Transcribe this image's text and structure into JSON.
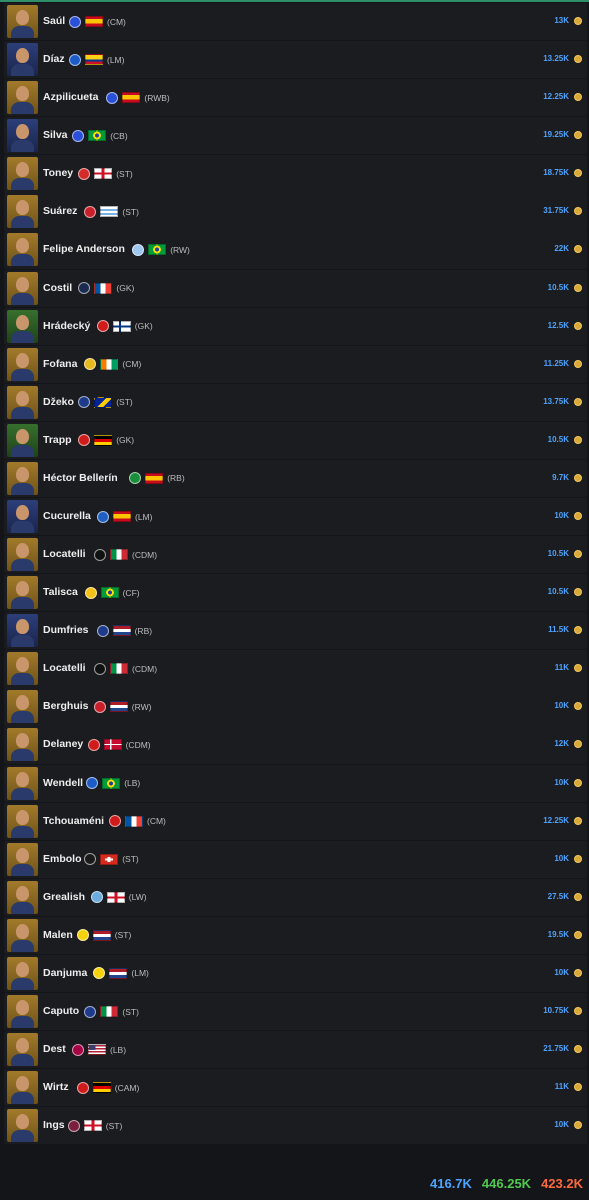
{
  "players": [
    {
      "name": "Saúl",
      "pos": "(CM)",
      "price": "13K",
      "club": "#2a4fd8",
      "flag": "es",
      "avatar": "gold"
    },
    {
      "name": "Díaz",
      "pos": "(LM)",
      "price": "13.25K",
      "club": "#1d5cc8",
      "flag": "co",
      "avatar": "blue"
    },
    {
      "name": "Azpilicueta",
      "pos": "(RWB)",
      "price": "12.25K",
      "club": "#2a4fd8",
      "flag": "es",
      "avatar": "gold"
    },
    {
      "name": "Silva",
      "pos": "(CB)",
      "price": "19.25K",
      "club": "#2a4fd8",
      "flag": "br",
      "avatar": "blue"
    },
    {
      "name": "Toney",
      "pos": "(ST)",
      "price": "18.75K",
      "club": "#d42a2a",
      "flag": "en",
      "avatar": "gold"
    },
    {
      "name": "Suárez",
      "pos": "(ST)",
      "price": "31.75K",
      "club": "#c8202b",
      "flag": "uy",
      "avatar": "gold"
    },
    {
      "name": "Felipe Anderson",
      "pos": "(RW)",
      "price": "22K",
      "club": "#9ec8ef",
      "flag": "br",
      "avatar": "gold"
    },
    {
      "name": "Costil",
      "pos": "(GK)",
      "price": "10.5K",
      "club": "#1b2a4e",
      "flag": "fr",
      "avatar": "gold"
    },
    {
      "name": "Hrádecký",
      "pos": "(GK)",
      "price": "12.5K",
      "club": "#d01b1b",
      "flag": "fi",
      "avatar": "green"
    },
    {
      "name": "Fofana",
      "pos": "(CM)",
      "price": "11.25K",
      "club": "#e7b91c",
      "flag": "ci",
      "avatar": "gold"
    },
    {
      "name": "Džeko",
      "pos": "(ST)",
      "price": "13.75K",
      "club": "#1e3a8a",
      "flag": "ba",
      "avatar": "gold"
    },
    {
      "name": "Trapp",
      "pos": "(GK)",
      "price": "10.5K",
      "club": "#d01b1b",
      "flag": "de",
      "avatar": "green"
    },
    {
      "name": "Héctor Bellerín",
      "pos": "(RB)",
      "price": "9.7K",
      "club": "#1a8f3b",
      "flag": "es",
      "avatar": "gold"
    },
    {
      "name": "Cucurella",
      "pos": "(LM)",
      "price": "10K",
      "club": "#1f5fc2",
      "flag": "es",
      "avatar": "blue"
    },
    {
      "name": "Locatelli",
      "pos": "(CDM)",
      "price": "10.5K",
      "club": "#111111",
      "flag": "it",
      "avatar": "gold"
    },
    {
      "name": "Talisca",
      "pos": "(CF)",
      "price": "10.5K",
      "club": "#f2c11a",
      "flag": "br",
      "avatar": "gold"
    },
    {
      "name": "Dumfries",
      "pos": "(RB)",
      "price": "11.5K",
      "club": "#1e3a8a",
      "flag": "nl",
      "avatar": "blue"
    },
    {
      "name": "Locatelli",
      "pos": "(CDM)",
      "price": "11K",
      "club": "#111111",
      "flag": "it",
      "avatar": "gold"
    },
    {
      "name": "Berghuis",
      "pos": "(RW)",
      "price": "10K",
      "club": "#c8202b",
      "flag": "nl",
      "avatar": "gold"
    },
    {
      "name": "Delaney",
      "pos": "(CDM)",
      "price": "12K",
      "club": "#d01b1b",
      "flag": "dk",
      "avatar": "gold"
    },
    {
      "name": "Wendell",
      "pos": "(LB)",
      "price": "10K",
      "club": "#1d5cc8",
      "flag": "br",
      "avatar": "gold"
    },
    {
      "name": "Tchouaméni",
      "pos": "(CM)",
      "price": "12.25K",
      "club": "#d01b1b",
      "flag": "fr",
      "avatar": "gold"
    },
    {
      "name": "Embolo",
      "pos": "(ST)",
      "price": "10K",
      "club": "#1a1a1a",
      "flag": "ch",
      "avatar": "gold"
    },
    {
      "name": "Grealish",
      "pos": "(LW)",
      "price": "27.5K",
      "club": "#6cabdd",
      "flag": "en",
      "avatar": "gold"
    },
    {
      "name": "Malen",
      "pos": "(ST)",
      "price": "19.5K",
      "club": "#f5d20c",
      "flag": "nl",
      "avatar": "gold"
    },
    {
      "name": "Danjuma",
      "pos": "(LM)",
      "price": "10K",
      "club": "#f5d20c",
      "flag": "nl",
      "avatar": "gold"
    },
    {
      "name": "Caputo",
      "pos": "(ST)",
      "price": "10.75K",
      "club": "#1e3a8a",
      "flag": "it",
      "avatar": "gold"
    },
    {
      "name": "Dest",
      "pos": "(LB)",
      "price": "21.75K",
      "club": "#a50044",
      "flag": "us",
      "avatar": "gold"
    },
    {
      "name": "Wirtz",
      "pos": "(CAM)",
      "price": "11K",
      "club": "#d01b1b",
      "flag": "de",
      "avatar": "gold"
    },
    {
      "name": "Ings",
      "pos": "(ST)",
      "price": "10K",
      "club": "#7a1f3d",
      "flag": "en",
      "avatar": "gold"
    }
  ],
  "totals": {
    "total_1": "416.7K",
    "total_2": "446.25K",
    "total_3": "423.2K"
  },
  "colors": {
    "price": "#4da3ff",
    "total_1": "#4da3ff",
    "total_2": "#4fc94f",
    "total_3": "#ff6a3d",
    "background": "#141518",
    "row": "#1b1c20"
  }
}
